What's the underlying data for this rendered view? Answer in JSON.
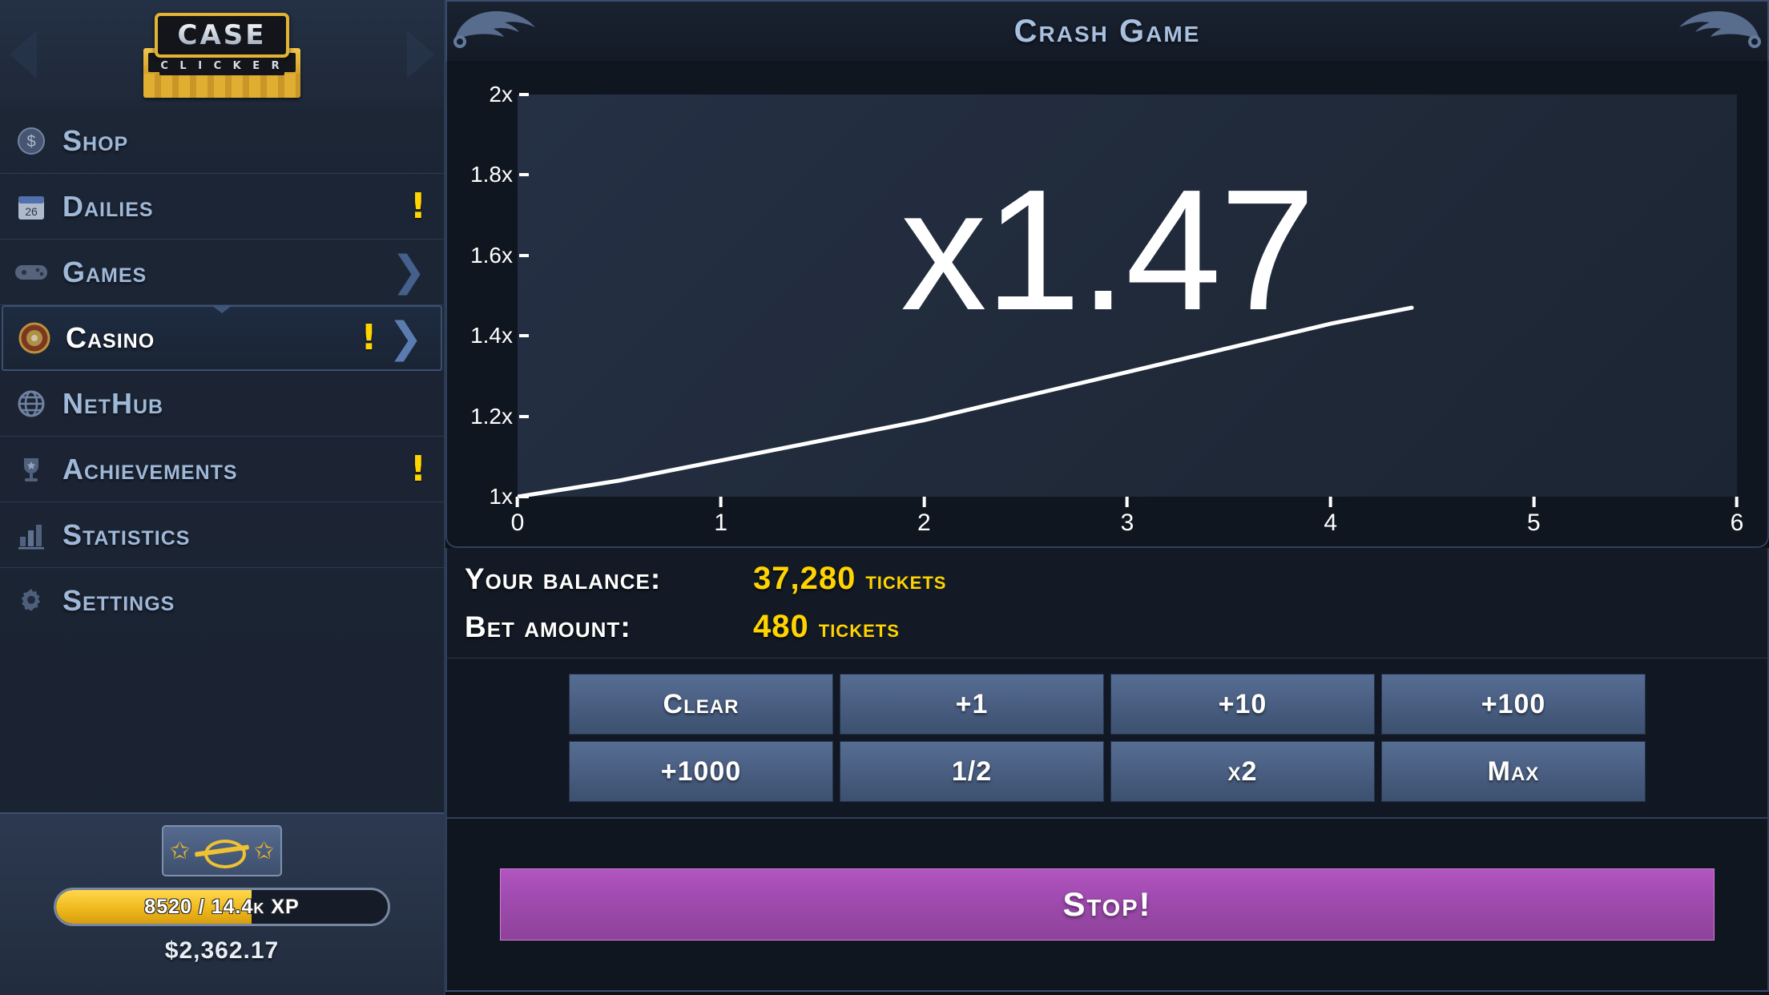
{
  "sidebar": {
    "logo": {
      "top": "CASE",
      "bottom": "C L I C K E R"
    },
    "items": [
      {
        "label": "Shop",
        "icon": "coin-icon",
        "badge": "",
        "chevron": ""
      },
      {
        "label": "Dailies",
        "icon": "calendar-icon",
        "badge": "!",
        "chevron": ""
      },
      {
        "label": "Games",
        "icon": "gamepad-icon",
        "badge": "",
        "chevron": "❯"
      },
      {
        "label": "Casino",
        "icon": "roulette-icon",
        "badge": "!",
        "chevron": "❯"
      },
      {
        "label": "NetHub",
        "icon": "globe-icon",
        "badge": "",
        "chevron": ""
      },
      {
        "label": "Achievements",
        "icon": "trophy-icon",
        "badge": "!",
        "chevron": ""
      },
      {
        "label": "Statistics",
        "icon": "bar-chart-icon",
        "badge": "",
        "chevron": ""
      },
      {
        "label": "Settings",
        "icon": "gear-icon",
        "badge": "",
        "chevron": ""
      }
    ],
    "active_index": 3,
    "footer": {
      "rank_icon": "ak47-laurel-rank-icon",
      "xp_text": "8520 / 14.4k XP",
      "xp_percent": 59,
      "cash": "$2,362.17"
    }
  },
  "header": {
    "title": "Crash Game",
    "decoration_left": "karambit-knife-icon",
    "decoration_right": "karambit-knife-icon"
  },
  "chart_data": {
    "type": "line",
    "title": "",
    "xlabel": "",
    "ylabel": "",
    "xlim": [
      0,
      6
    ],
    "ylim": [
      1,
      2
    ],
    "grid": false,
    "legend": "none",
    "x_ticks": [
      "0",
      "1",
      "2",
      "3",
      "4",
      "5",
      "6"
    ],
    "y_ticks": [
      "1x",
      "1.2x",
      "1.4x",
      "1.6x",
      "1.8x",
      "2x"
    ],
    "series": [
      {
        "name": "multiplier",
        "color": "#ffffff",
        "x": [
          0.0,
          0.5,
          1.0,
          1.5,
          2.0,
          2.5,
          3.0,
          3.5,
          4.0,
          4.4
        ],
        "y": [
          1.0,
          1.04,
          1.09,
          1.14,
          1.19,
          1.25,
          1.31,
          1.37,
          1.43,
          1.47
        ]
      }
    ],
    "annotation": "x1.47",
    "current_multiplier": 1.47
  },
  "stats": {
    "balance_label": "Your balance:",
    "balance_value": "37,280",
    "balance_unit": "tickets",
    "bet_label": "Bet amount:",
    "bet_value": "480",
    "bet_unit": "tickets"
  },
  "bet_buttons": [
    {
      "label": "Clear"
    },
    {
      "label": "+1"
    },
    {
      "label": "+10"
    },
    {
      "label": "+100"
    },
    {
      "label": "+1000"
    },
    {
      "label": "1/2"
    },
    {
      "label": "x2"
    },
    {
      "label": "Max"
    }
  ],
  "action": {
    "stop_label": "Stop!"
  },
  "colors": {
    "accent_yellow": "#ffd400",
    "nav_blue": "#9fb8d8",
    "stop_purple": "#a04bb0",
    "panel_bg": "#10161f",
    "line_white": "#ffffff"
  }
}
